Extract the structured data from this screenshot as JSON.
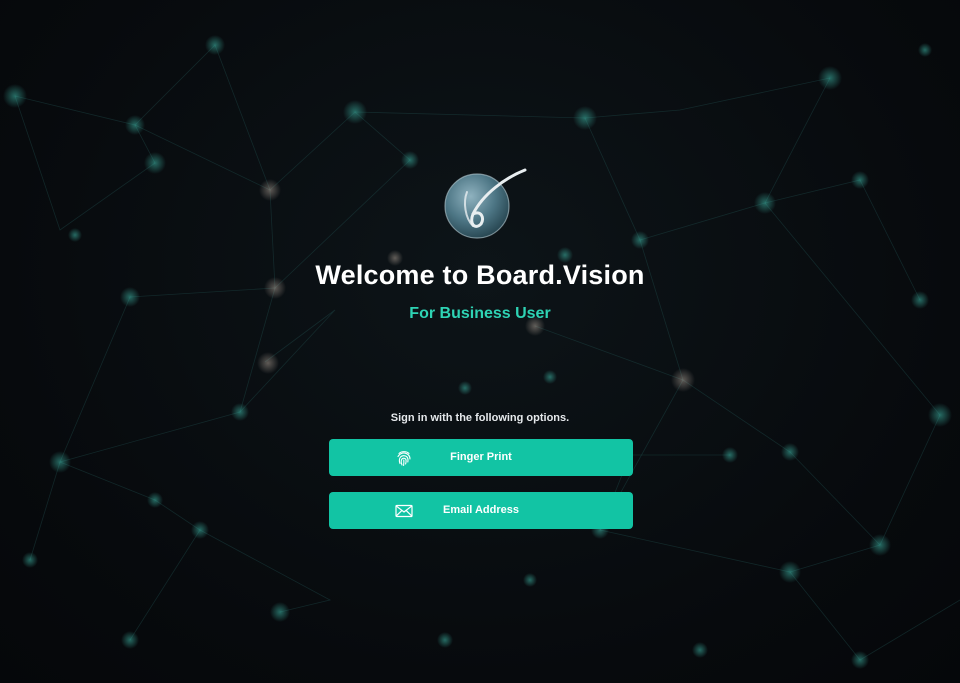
{
  "welcome": {
    "title": "Welcome to Board.Vision",
    "subtitle": "For Business User"
  },
  "signin": {
    "hint": "Sign in with the following options.",
    "options": [
      {
        "label": "Finger Print",
        "icon": "fingerprint-icon"
      },
      {
        "label": "Email Address",
        "icon": "envelope-icon"
      }
    ]
  },
  "colors": {
    "background": "#080c10",
    "accent": "#12c4a4",
    "subtitle": "#2ed3b4",
    "title": "#ffffff"
  }
}
